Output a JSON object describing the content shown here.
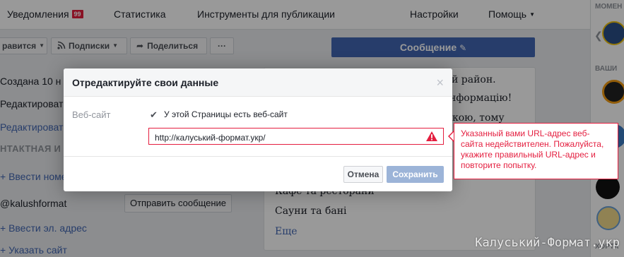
{
  "topnav": {
    "notifications_label": "Уведомления",
    "notifications_count": "99",
    "stats_label": "Статистика",
    "publishing_tools_label": "Инструменты для публикации",
    "settings_label": "Настройки",
    "help_label": "Помощь"
  },
  "actionbar": {
    "like_label": "равится",
    "follow_label": "Подписки",
    "share_label": "Поделиться",
    "more_label": "···",
    "message_label": "Сообщение"
  },
  "left": {
    "created_text": "Создана 10 н",
    "edit_text": "Редактироват",
    "edit_link": "Редактироват",
    "contact_heading": "НТАКТНАЯ И",
    "add_phone": "+ Ввести номе",
    "username": "@kalushformat",
    "send_message": "Отправить сообщение",
    "add_email": "+ Ввести эл. адрес",
    "add_site": "+ Указать сайт"
  },
  "right": {
    "line1": "й район.",
    "line2": "нформацію!",
    "line3": "кою, тому",
    "line4": "Кафе та ресторани",
    "line5": "Сауни та бані",
    "more": "Еще"
  },
  "sidebar": {
    "label1": "МОМЕН",
    "label2": "ВАШИ",
    "label3": "ХОРТА"
  },
  "dialog": {
    "title": "Отредактируйте свои данные",
    "close": "×",
    "field_label": "Веб-сайт",
    "checkbox_label": "У этой Страницы есть веб-сайт",
    "url_value": "http://калуський-формат.укр/",
    "cancel": "Отмена",
    "save": "Сохранить"
  },
  "error": {
    "message": "Указанный вами URL-адрес веб-сайта недействителен. Пожалуйста, укажите правильный URL-адрес и повторите попытку."
  },
  "watermark": "Калуський-Формат.укр",
  "colors": {
    "accent": "#4267b2",
    "error": "#e41e3f",
    "save_disabled": "#9cb4d8"
  }
}
